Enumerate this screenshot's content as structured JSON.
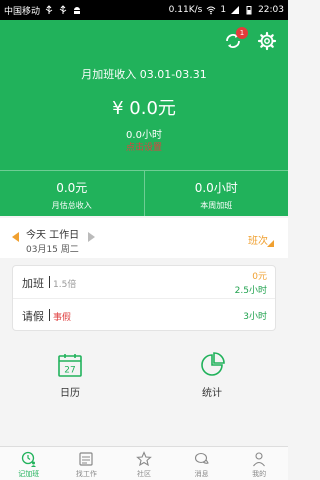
{
  "status_bar": {
    "carrier": "中国移动",
    "speed": "0.11K/s",
    "battery": "1",
    "time": "22:03"
  },
  "header": {
    "period": "月加班收入 03.01-03.31",
    "amount": "¥ 0.0元",
    "hours": "0.0小时",
    "hint": "点击设置",
    "badge_count": "1"
  },
  "stats": [
    {
      "value": "0.0元",
      "label": "月估总收入"
    },
    {
      "value": "0.0小时",
      "label": "本周加班"
    }
  ],
  "date_bar": {
    "today": "今天 工作日",
    "date": "03月15 周二",
    "shift": "班次"
  },
  "overtime": {
    "label": "加班",
    "multiplier": "1.5倍",
    "money": "0元",
    "hours": "2.5小时"
  },
  "leave": {
    "label": "请假",
    "type": "事假",
    "hours": "3小时"
  },
  "tools": [
    {
      "label": "日历",
      "day": "27",
      "icon": "calendar-icon"
    },
    {
      "label": "统计",
      "icon": "pie-chart-icon"
    }
  ],
  "tabs": [
    {
      "label": "记加班",
      "icon": "clock-user-icon"
    },
    {
      "label": "找工作",
      "icon": "id-card-icon"
    },
    {
      "label": "社区",
      "icon": "star-icon"
    },
    {
      "label": "消息",
      "icon": "chat-icon"
    },
    {
      "label": "我的",
      "icon": "person-icon"
    }
  ],
  "colors": {
    "brand": "#21b25b",
    "accent": "#f0a030",
    "alert": "#e04040"
  }
}
